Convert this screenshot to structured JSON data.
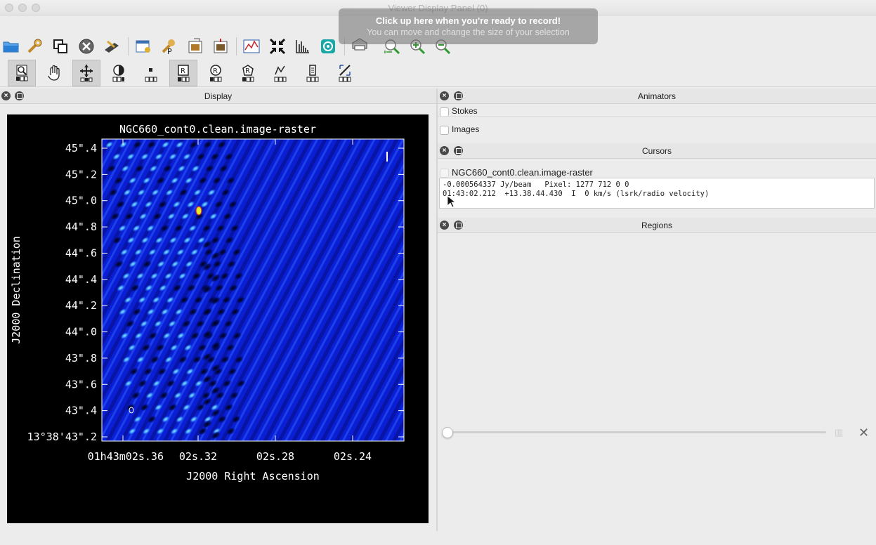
{
  "window": {
    "title": "Viewer Display Panel (0)"
  },
  "overlay": {
    "line1": "Click up here when you're ready to record!",
    "line2": "You can move and change the size of your selection"
  },
  "toolbar_main": [
    {
      "name": "open-icon",
      "color": "#2a7fd4"
    },
    {
      "name": "wrench-icon",
      "color": "#c08a2a"
    },
    {
      "name": "copy-icon",
      "color": "#333333"
    },
    {
      "name": "close-data-icon",
      "color": "#555555"
    },
    {
      "name": "save-icon",
      "color": "#444444"
    },
    {
      "name": "adjust-icon",
      "color": "#3a6fb0"
    },
    {
      "name": "print-options-icon",
      "color": "#333333"
    },
    {
      "name": "image-export-icon",
      "color": "#7a5a2a"
    },
    {
      "name": "image-save-icon",
      "color": "#7a5a2a"
    },
    {
      "name": "profile-icon",
      "color": "#2a5aa8"
    },
    {
      "name": "fit-icon",
      "color": "#111111"
    },
    {
      "name": "histogram-icon",
      "color": "#222222"
    },
    {
      "name": "circle-target-icon",
      "color": "#1aa7a7"
    },
    {
      "name": "printer-icon",
      "color": "#333333"
    },
    {
      "name": "zoom-fit-icon",
      "color": "#2e9a2e"
    },
    {
      "name": "zoom-in-icon",
      "color": "#2e9a2e"
    },
    {
      "name": "zoom-out-icon",
      "color": "#2e9a2e"
    }
  ],
  "toolbar_mouse": [
    {
      "name": "zoom-tool-icon",
      "active": true
    },
    {
      "name": "pan-tool-icon",
      "active": false
    },
    {
      "name": "move-tool-icon",
      "active": true
    },
    {
      "name": "contrast-tool-icon",
      "active": false
    },
    {
      "name": "point-tool-icon",
      "active": false
    },
    {
      "name": "rectangle-region-icon",
      "active": true
    },
    {
      "name": "ellipse-region-icon",
      "active": false
    },
    {
      "name": "polygon-region-icon",
      "active": false
    },
    {
      "name": "polyline-region-icon",
      "active": false
    },
    {
      "name": "position-tool-icon",
      "active": false
    },
    {
      "name": "ruler-tool-icon",
      "active": false
    }
  ],
  "display_panel": {
    "title": "Display"
  },
  "image": {
    "title": "NGC660_cont0.clean.image-raster",
    "ylabel": "J2000 Declination",
    "xlabel": "J2000 Right Ascension",
    "y_ticks": [
      "45\".4",
      "45\".2",
      "45\".0",
      "44\".8",
      "44\".6",
      "44\".4",
      "44\".2",
      "44\".0",
      "43\".8",
      "43\".6",
      "43\".4",
      "13°38'43\".2"
    ],
    "x_ticks": [
      "02s.36",
      "02s.32",
      "02s.28",
      "02s.24"
    ],
    "x_first_prefix": "01h43m",
    "colors": {
      "bg": "#0a1acc",
      "bright": "#4fb2ff",
      "dark": "#000014"
    }
  },
  "animators": {
    "title": "Animators",
    "items": [
      "Stokes",
      "Images"
    ]
  },
  "cursors": {
    "title": "Cursors",
    "image_name": "NGC660_cont0.clean.image-raster",
    "line1": "-0.000564337 Jy/beam   Pixel: 1277 712 0 0",
    "line2": "01:43:02.212  +13.38.44.430  I  0 km/s (lsrk/radio velocity)"
  },
  "regions": {
    "title": "Regions"
  }
}
